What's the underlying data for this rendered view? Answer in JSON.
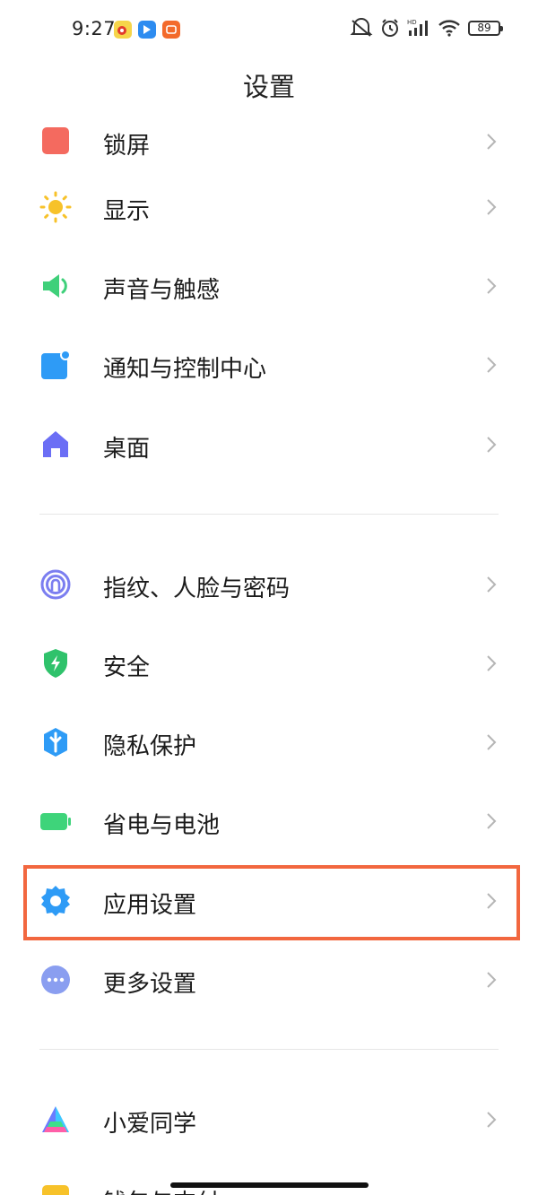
{
  "status_bar": {
    "time": "9:27",
    "battery_level": "89"
  },
  "header": {
    "title": "设置"
  },
  "items": [
    {
      "label": "锁屏",
      "icon": "lock-screen-icon",
      "color": "#f46a5f"
    },
    {
      "label": "显示",
      "icon": "sun-icon",
      "color": "#f7c22a"
    },
    {
      "label": "声音与触感",
      "icon": "speaker-icon",
      "color": "#3fd07a"
    },
    {
      "label": "通知与控制中心",
      "icon": "notification-icon",
      "color": "#2e9bf6"
    },
    {
      "label": "桌面",
      "icon": "home-icon",
      "color": "#6b6ef5"
    },
    {
      "label": "指纹、人脸与密码",
      "icon": "fingerprint-icon",
      "color": "#7b7ef0"
    },
    {
      "label": "安全",
      "icon": "shield-icon",
      "color": "#2fc26b"
    },
    {
      "label": "隐私保护",
      "icon": "privacy-icon",
      "color": "#2e9bf6"
    },
    {
      "label": "省电与电池",
      "icon": "battery-icon",
      "color": "#3ed47a"
    },
    {
      "label": "应用设置",
      "icon": "gear-icon",
      "color": "#2e9bf6"
    },
    {
      "label": "更多设置",
      "icon": "more-icon",
      "color": "#8a9ef0"
    },
    {
      "label": "小爱同学",
      "icon": "xiaoai-icon",
      "color": "#3ec7ff"
    },
    {
      "label": "钱包与支付",
      "icon": "wallet-icon",
      "color": "#f7c22a"
    }
  ],
  "highlight_color": "#f2673f"
}
